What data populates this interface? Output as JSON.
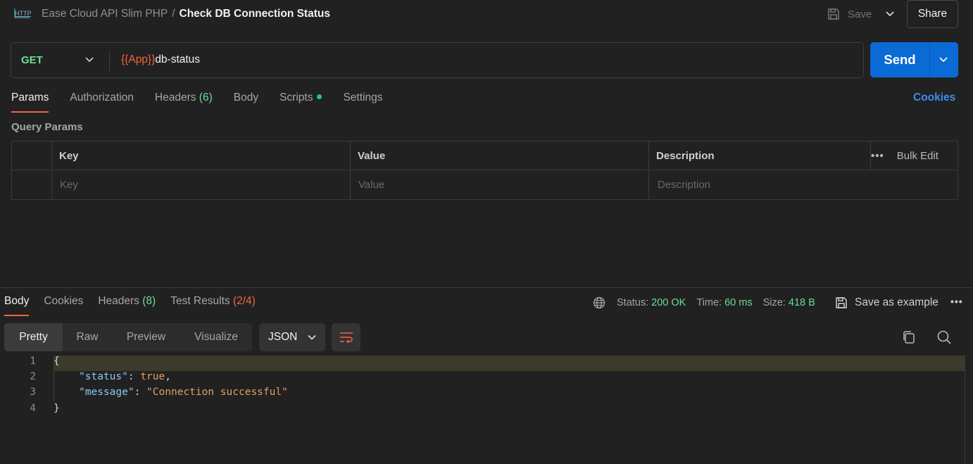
{
  "header": {
    "collection": "Ease Cloud API Slim PHP",
    "separator": "/",
    "request_title": "Check DB Connection Status",
    "save_label": "Save",
    "share_label": "Share"
  },
  "url_bar": {
    "method": "GET",
    "url_variable": "{{App}}",
    "url_path": "db-status",
    "send_label": "Send"
  },
  "request_tabs": [
    {
      "label": "Params",
      "count": ""
    },
    {
      "label": "Authorization",
      "count": ""
    },
    {
      "label": "Headers",
      "count": "(6)"
    },
    {
      "label": "Body",
      "count": ""
    },
    {
      "label": "Scripts",
      "count": ""
    },
    {
      "label": "Settings",
      "count": ""
    }
  ],
  "cookies_label": "Cookies",
  "query_params": {
    "section_label": "Query Params",
    "columns": [
      "Key",
      "Value",
      "Description"
    ],
    "bulk_edit_label": "Bulk Edit",
    "placeholders": {
      "key": "Key",
      "value": "Value",
      "description": "Description"
    }
  },
  "response": {
    "tabs": [
      {
        "label": "Body",
        "count": ""
      },
      {
        "label": "Cookies",
        "count": ""
      },
      {
        "label": "Headers",
        "count": "(8)"
      },
      {
        "label": "Test Results",
        "count": "(2/4)"
      }
    ],
    "status_label": "Status:",
    "status_value": "200 OK",
    "time_label": "Time:",
    "time_value": "60 ms",
    "size_label": "Size:",
    "size_value": "418 B",
    "save_example_label": "Save as example",
    "view_modes": [
      "Pretty",
      "Raw",
      "Preview",
      "Visualize"
    ],
    "format": "JSON",
    "code_lines": [
      {
        "num": "1",
        "text": "{"
      },
      {
        "num": "2",
        "key": "\"status\"",
        "value": "true"
      },
      {
        "num": "3",
        "key": "\"message\"",
        "value": "\"Connection successful\""
      },
      {
        "num": "4",
        "text": "}"
      }
    ]
  },
  "colors": {
    "accent": "#f2663c",
    "send": "#0b6bd6",
    "success": "#6bdd9a",
    "link": "#3c8df0"
  }
}
